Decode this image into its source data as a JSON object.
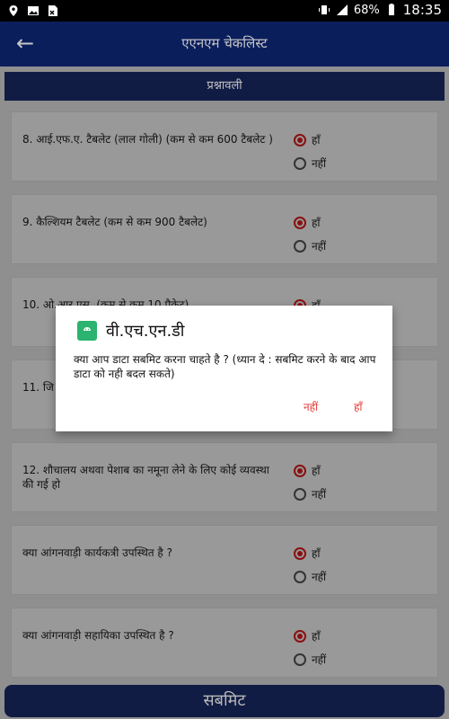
{
  "status_bar": {
    "battery": "68%",
    "time": "18:35"
  },
  "app_bar": {
    "title": "एएनएम चेकलिस्ट"
  },
  "section": {
    "title": "प्रश्नावली"
  },
  "options": {
    "yes": "हाँ",
    "no": "नहीं"
  },
  "questions": [
    {
      "text": "8. आई.एफ.ए. टैबलेट (लाल गोली) (कम से कम 600 टैबलेट )",
      "selected": "yes"
    },
    {
      "text": "9. कैल्शियम टैबलेट (कम से कम 900 टैबलेट)",
      "selected": "yes"
    },
    {
      "text": "10.  ओ.आर.एस. (कम से कम 10 पैकेट)",
      "selected": "yes"
    },
    {
      "text": "11.  जि",
      "selected": "yes"
    },
    {
      "text": "12.  शौचालय अथवा पेशाब का नमूना लेने के लिए कोई व्यवस्था की गई हो",
      "selected": "yes"
    },
    {
      "text": "क्या आंगनवाड़ी कार्यकत्री उपस्थित है ?",
      "selected": "yes"
    },
    {
      "text": "क्या  आंगनवाड़ी सहायिका उपस्थित है ?",
      "selected": "yes"
    }
  ],
  "submit_label": "सबमिट",
  "dialog": {
    "title": "वी.एच.एन.डी",
    "message": "क्या आप डाटा सबमिट करना चाहते है ? (ध्यान दे : सबमिट करने के बाद आप डाटा को नही बदल सकते)",
    "no_label": "नहीं",
    "yes_label": "हाँ"
  },
  "colors": {
    "appbar": "#0b1e5c",
    "accent": "#8a1010",
    "dialog_button": "#e53935"
  }
}
